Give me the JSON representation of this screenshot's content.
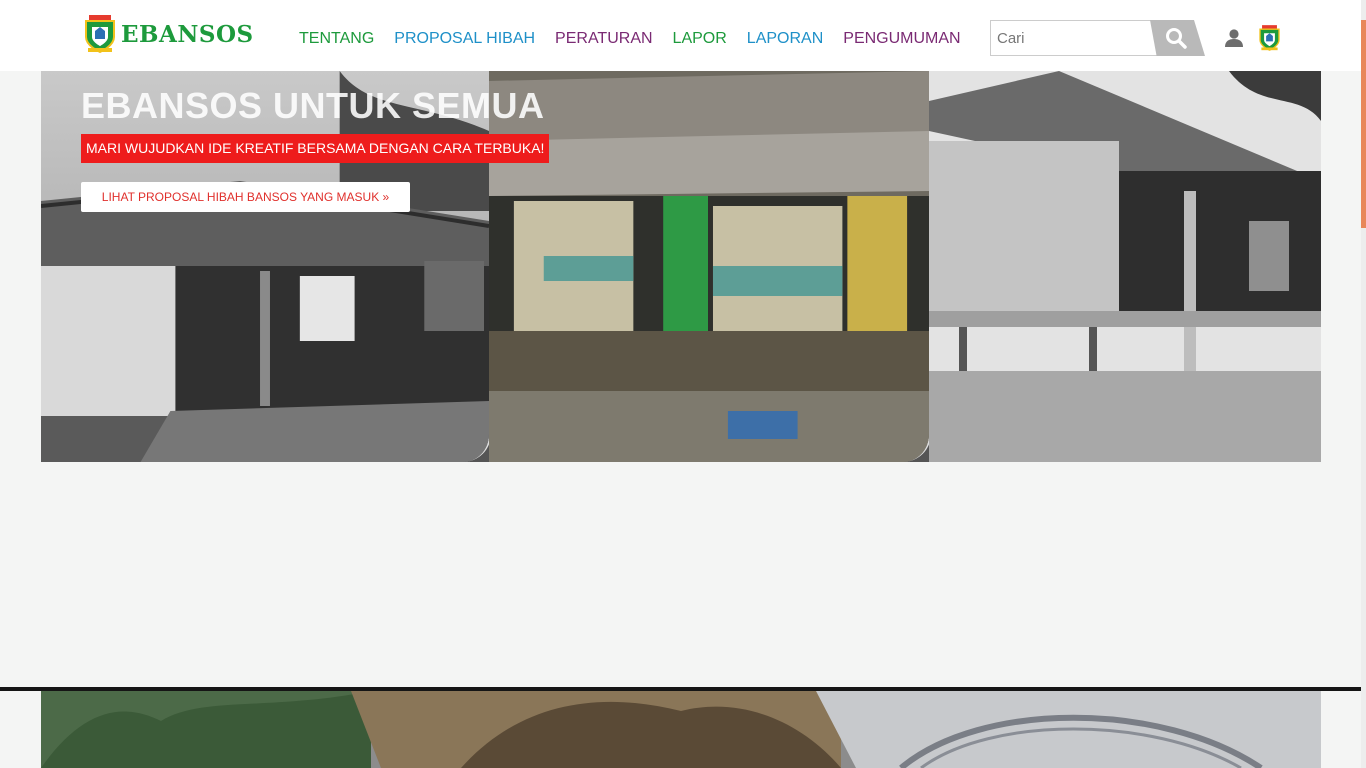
{
  "brand": {
    "name": "EBANSOS",
    "color": "#1d9a3c"
  },
  "nav": [
    {
      "label": "TENTANG",
      "color": "#1d9a3c"
    },
    {
      "label": "PROPOSAL HIBAH",
      "color": "#1e90c8"
    },
    {
      "label": "PERATURAN",
      "color": "#7a2a73"
    },
    {
      "label": "LAPOR",
      "color": "#1d9a3c"
    },
    {
      "label": "LAPORAN",
      "color": "#1e90c8"
    },
    {
      "label": "PENGUMUMAN",
      "color": "#7a2a73"
    }
  ],
  "search": {
    "placeholder": "Cari",
    "button_icon": "search-icon"
  },
  "account": {
    "icon": "user-icon",
    "emblem_icon": "emblem-icon"
  },
  "hero": {
    "title": "EBANSOS UNTUK SEMUA",
    "subtitle": "MARI WUJUDKAN IDE KREATIF BERSAMA DENGAN CARA TERBUKA!",
    "cta_label": "LIHAT PROPOSAL HIBAH BANSOS YANG MASUK »",
    "subtitle_bg": "#ee1c1c"
  }
}
